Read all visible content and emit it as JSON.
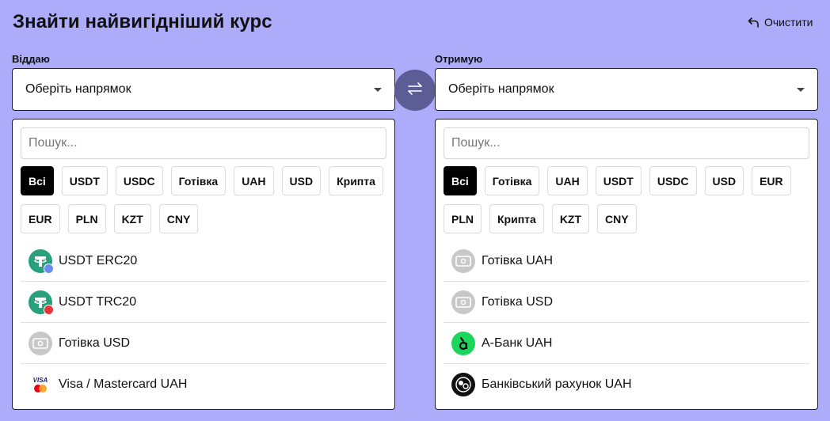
{
  "header": {
    "title": "Знайти найвигідніший курс",
    "clear_label": "Очистити"
  },
  "give": {
    "label": "Віддаю",
    "select_value": "Оберіть напрямок",
    "search_placeholder": "Пошук...",
    "filters": [
      "Всі",
      "USDT",
      "USDC",
      "Готівка",
      "UAH",
      "USD",
      "Крипта",
      "EUR",
      "PLN",
      "KZT",
      "CNY"
    ],
    "active_filter": "Всі",
    "items": [
      {
        "label": "USDT ERC20",
        "icon": "tether-erc20-icon"
      },
      {
        "label": "USDT TRC20",
        "icon": "tether-trc20-icon"
      },
      {
        "label": "Готівка USD",
        "icon": "cash-icon"
      },
      {
        "label": "Visa / Mastercard UAH",
        "icon": "visa-mastercard-icon"
      }
    ]
  },
  "receive": {
    "label": "Отримую",
    "select_value": "Оберіть напрямок",
    "search_placeholder": "Пошук...",
    "filters": [
      "Всі",
      "Готівка",
      "UAH",
      "USDT",
      "USDC",
      "USD",
      "EUR",
      "PLN",
      "Крипта",
      "KZT",
      "CNY"
    ],
    "active_filter": "Всі",
    "items": [
      {
        "label": "Готівка UAH",
        "icon": "cash-icon"
      },
      {
        "label": "Готівка USD",
        "icon": "cash-icon"
      },
      {
        "label": "А-Банк UAH",
        "icon": "abank-icon"
      },
      {
        "label": "Банківський рахунок UAH",
        "icon": "bank-account-icon"
      }
    ]
  },
  "colors": {
    "background": "#acacfb",
    "swap_button": "#5d5d96",
    "tether": "#26a17b",
    "abank": "#1bd65b",
    "active_chip": "#000000"
  }
}
